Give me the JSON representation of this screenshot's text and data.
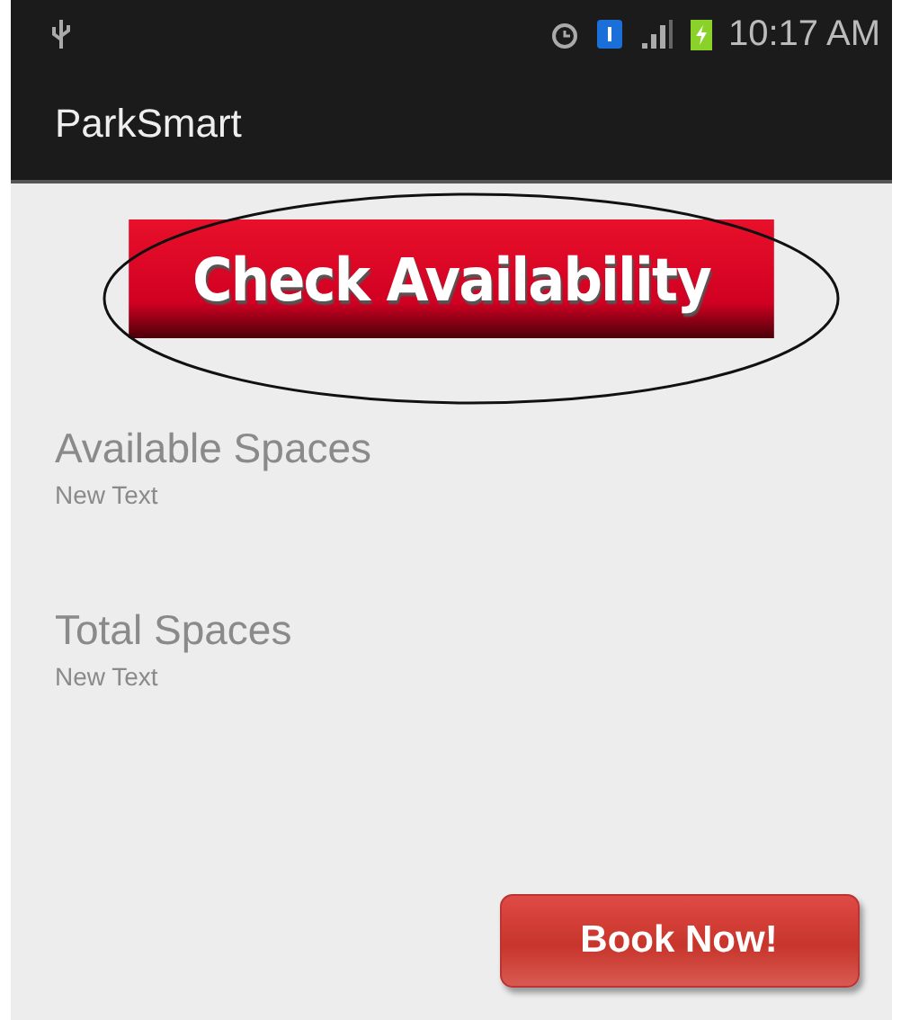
{
  "status_bar": {
    "time": "10:17 AM"
  },
  "app_bar": {
    "title": "ParkSmart"
  },
  "check_button": {
    "label": "Check Availability",
    "circled": true
  },
  "fields": [
    {
      "label": "Available Spaces",
      "value": "New Text"
    },
    {
      "label": "Total Spaces",
      "value": "New Text"
    }
  ],
  "book_button": {
    "label": "Book Now!"
  }
}
